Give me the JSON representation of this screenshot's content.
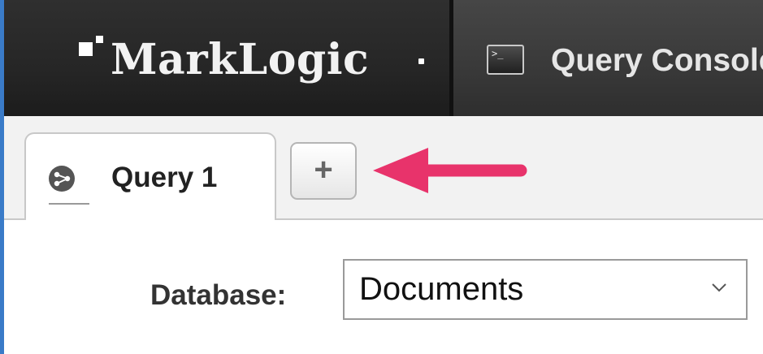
{
  "header": {
    "logo_text": "MarkLogic",
    "app_title": "Query Console",
    "console_icon_glyph": ">_"
  },
  "tabs": [
    {
      "label": "Query 1",
      "icon": "query-tab-icon",
      "active": true
    }
  ],
  "add_tab_label": "+",
  "annotation": {
    "type": "arrow",
    "color": "#e8336b",
    "points_to": "add-tab-button"
  },
  "database": {
    "label": "Database:",
    "selected": "Documents"
  },
  "colors": {
    "header_dark": "#262626",
    "header_console": "#3a3a3a",
    "tabstrip": "#f2f2f2",
    "accent_arrow": "#e8336b",
    "left_edge": "#3a7bc8"
  }
}
